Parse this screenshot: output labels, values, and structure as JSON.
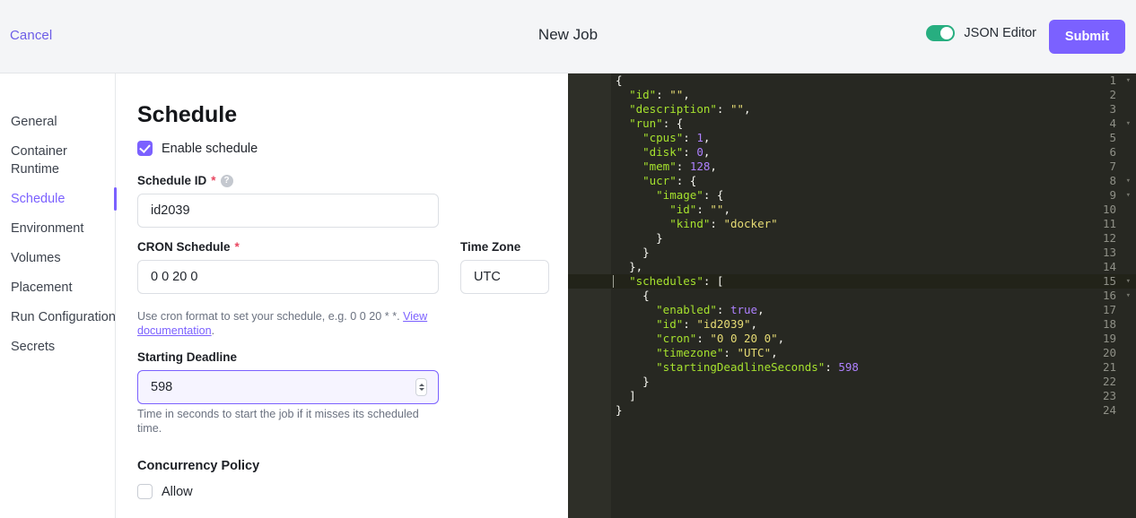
{
  "header": {
    "cancel_label": "Cancel",
    "title": "New Job",
    "json_editor_label": "JSON Editor",
    "json_editor_enabled": true,
    "submit_label": "Submit",
    "accent_color": "#7b61ff",
    "toggle_on_color": "#27ae80"
  },
  "sidebar": {
    "items": [
      {
        "label": "General",
        "active": false
      },
      {
        "label": "Container Runtime",
        "active": false
      },
      {
        "label": "Schedule",
        "active": true
      },
      {
        "label": "Environment",
        "active": false
      },
      {
        "label": "Volumes",
        "active": false
      },
      {
        "label": "Placement",
        "active": false
      },
      {
        "label": "Run Configuration",
        "active": false
      },
      {
        "label": "Secrets",
        "active": false
      }
    ]
  },
  "form": {
    "title": "Schedule",
    "enable_schedule": {
      "label": "Enable schedule",
      "checked": true
    },
    "schedule_id": {
      "label": "Schedule ID",
      "required_marker": "*",
      "help_icon_glyph": "?",
      "value": "id2039"
    },
    "cron_schedule": {
      "label": "CRON Schedule",
      "required_marker": "*",
      "value": "0 0 20 0",
      "hint_prefix": "Use cron format to set your schedule, e.g. 0 0 20 * *. ",
      "hint_link": "View documentation",
      "hint_suffix": "."
    },
    "time_zone": {
      "label": "Time Zone",
      "value": "UTC"
    },
    "starting_deadline": {
      "label": "Starting Deadline",
      "value": "598",
      "focused": true,
      "hint": "Time in seconds to start the job if it misses its scheduled time."
    },
    "concurrency_policy": {
      "title": "Concurrency Policy",
      "allow_label": "Allow",
      "allow_checked": false
    }
  },
  "editor": {
    "background": "#272822",
    "active_line": 15,
    "lines": [
      {
        "num": 1,
        "fold": true,
        "indent": 0,
        "tokens": [
          {
            "t": "{",
            "c": "p"
          }
        ]
      },
      {
        "num": 2,
        "fold": false,
        "indent": 1,
        "tokens": [
          {
            "t": "\"id\"",
            "c": "k"
          },
          {
            "t": ": ",
            "c": "p"
          },
          {
            "t": "\"\"",
            "c": "s"
          },
          {
            "t": ",",
            "c": "p"
          }
        ]
      },
      {
        "num": 3,
        "fold": false,
        "indent": 1,
        "tokens": [
          {
            "t": "\"description\"",
            "c": "k"
          },
          {
            "t": ": ",
            "c": "p"
          },
          {
            "t": "\"\"",
            "c": "s"
          },
          {
            "t": ",",
            "c": "p"
          }
        ]
      },
      {
        "num": 4,
        "fold": true,
        "indent": 1,
        "tokens": [
          {
            "t": "\"run\"",
            "c": "k"
          },
          {
            "t": ": {",
            "c": "p"
          }
        ]
      },
      {
        "num": 5,
        "fold": false,
        "indent": 2,
        "tokens": [
          {
            "t": "\"cpus\"",
            "c": "k"
          },
          {
            "t": ": ",
            "c": "p"
          },
          {
            "t": "1",
            "c": "n"
          },
          {
            "t": ",",
            "c": "p"
          }
        ]
      },
      {
        "num": 6,
        "fold": false,
        "indent": 2,
        "tokens": [
          {
            "t": "\"disk\"",
            "c": "k"
          },
          {
            "t": ": ",
            "c": "p"
          },
          {
            "t": "0",
            "c": "n"
          },
          {
            "t": ",",
            "c": "p"
          }
        ]
      },
      {
        "num": 7,
        "fold": false,
        "indent": 2,
        "tokens": [
          {
            "t": "\"mem\"",
            "c": "k"
          },
          {
            "t": ": ",
            "c": "p"
          },
          {
            "t": "128",
            "c": "n"
          },
          {
            "t": ",",
            "c": "p"
          }
        ]
      },
      {
        "num": 8,
        "fold": true,
        "indent": 2,
        "tokens": [
          {
            "t": "\"ucr\"",
            "c": "k"
          },
          {
            "t": ": {",
            "c": "p"
          }
        ]
      },
      {
        "num": 9,
        "fold": true,
        "indent": 3,
        "tokens": [
          {
            "t": "\"image\"",
            "c": "k"
          },
          {
            "t": ": {",
            "c": "p"
          }
        ]
      },
      {
        "num": 10,
        "fold": false,
        "indent": 4,
        "tokens": [
          {
            "t": "\"id\"",
            "c": "k"
          },
          {
            "t": ": ",
            "c": "p"
          },
          {
            "t": "\"\"",
            "c": "s"
          },
          {
            "t": ",",
            "c": "p"
          }
        ]
      },
      {
        "num": 11,
        "fold": false,
        "indent": 4,
        "tokens": [
          {
            "t": "\"kind\"",
            "c": "k"
          },
          {
            "t": ": ",
            "c": "p"
          },
          {
            "t": "\"docker\"",
            "c": "s"
          }
        ]
      },
      {
        "num": 12,
        "fold": false,
        "indent": 3,
        "tokens": [
          {
            "t": "}",
            "c": "p"
          }
        ]
      },
      {
        "num": 13,
        "fold": false,
        "indent": 2,
        "tokens": [
          {
            "t": "}",
            "c": "p"
          }
        ]
      },
      {
        "num": 14,
        "fold": false,
        "indent": 1,
        "tokens": [
          {
            "t": "},",
            "c": "p"
          }
        ]
      },
      {
        "num": 15,
        "fold": true,
        "indent": 1,
        "tokens": [
          {
            "t": "\"schedules\"",
            "c": "k"
          },
          {
            "t": ": [",
            "c": "p"
          }
        ]
      },
      {
        "num": 16,
        "fold": true,
        "indent": 2,
        "tokens": [
          {
            "t": "{",
            "c": "p"
          }
        ]
      },
      {
        "num": 17,
        "fold": false,
        "indent": 3,
        "tokens": [
          {
            "t": "\"enabled\"",
            "c": "k"
          },
          {
            "t": ": ",
            "c": "p"
          },
          {
            "t": "true",
            "c": "n"
          },
          {
            "t": ",",
            "c": "p"
          }
        ]
      },
      {
        "num": 18,
        "fold": false,
        "indent": 3,
        "tokens": [
          {
            "t": "\"id\"",
            "c": "k"
          },
          {
            "t": ": ",
            "c": "p"
          },
          {
            "t": "\"id2039\"",
            "c": "s"
          },
          {
            "t": ",",
            "c": "p"
          }
        ]
      },
      {
        "num": 19,
        "fold": false,
        "indent": 3,
        "tokens": [
          {
            "t": "\"cron\"",
            "c": "k"
          },
          {
            "t": ": ",
            "c": "p"
          },
          {
            "t": "\"0 0 20 0\"",
            "c": "s"
          },
          {
            "t": ",",
            "c": "p"
          }
        ]
      },
      {
        "num": 20,
        "fold": false,
        "indent": 3,
        "tokens": [
          {
            "t": "\"timezone\"",
            "c": "k"
          },
          {
            "t": ": ",
            "c": "p"
          },
          {
            "t": "\"UTC\"",
            "c": "s"
          },
          {
            "t": ",",
            "c": "p"
          }
        ]
      },
      {
        "num": 21,
        "fold": false,
        "indent": 3,
        "tokens": [
          {
            "t": "\"startingDeadlineSeconds\"",
            "c": "k"
          },
          {
            "t": ": ",
            "c": "p"
          },
          {
            "t": "598",
            "c": "n"
          }
        ]
      },
      {
        "num": 22,
        "fold": false,
        "indent": 2,
        "tokens": [
          {
            "t": "}",
            "c": "p"
          }
        ]
      },
      {
        "num": 23,
        "fold": false,
        "indent": 1,
        "tokens": [
          {
            "t": "]",
            "c": "p"
          }
        ]
      },
      {
        "num": 24,
        "fold": false,
        "indent": 0,
        "tokens": [
          {
            "t": "}",
            "c": "p"
          }
        ]
      }
    ]
  }
}
